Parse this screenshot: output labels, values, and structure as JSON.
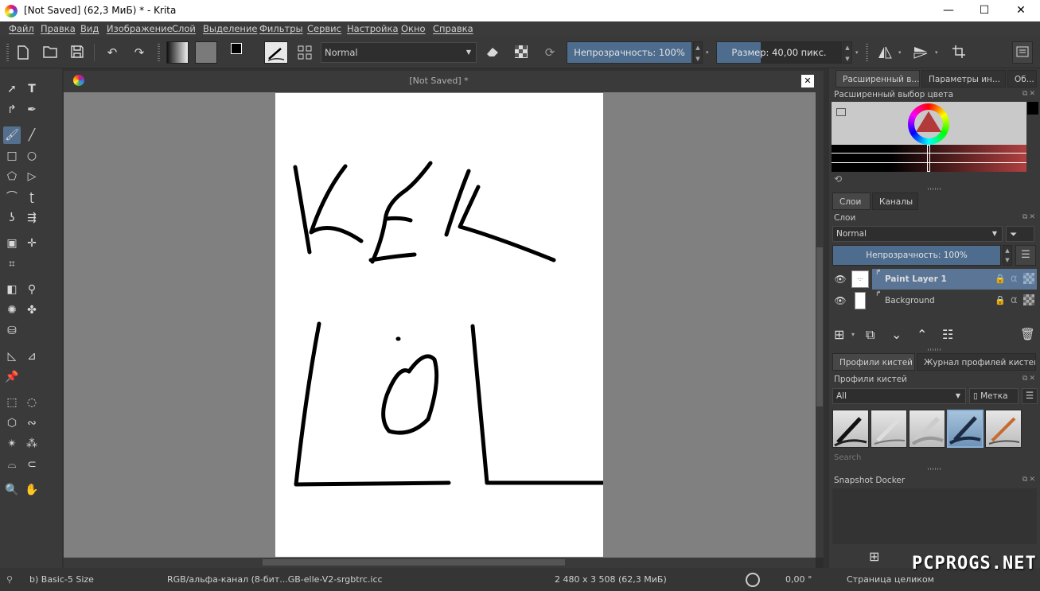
{
  "window": {
    "title": "[Not Saved]  (62,3 МиБ)  * - Krita",
    "minimize": "—",
    "maximize": "☐",
    "close": "✕"
  },
  "menu": [
    "Файл",
    "Правка",
    "Вид",
    "Изображение",
    "Слой",
    "Выделение",
    "Фильтры",
    "Сервис",
    "Настройка",
    "Окно",
    "Справка"
  ],
  "toolbar": {
    "blend_mode": "Normal",
    "opacity_label": "Непрозрачность: 100%",
    "opacity_value": 1.0,
    "size_label": "Размер: 40,00 пикс.",
    "size_fill": 0.35
  },
  "document": {
    "tab_title": "[Not Saved]  *",
    "close": "✕"
  },
  "dock": {
    "tabs": [
      "Расширенный в...",
      "Параметры ин...",
      "Об..."
    ],
    "color_selector_title": "Расширенный выбор цвета",
    "layer_tabs": [
      "Слои",
      "Каналы"
    ],
    "layers_title": "Слои",
    "layers_blend": "Normal",
    "layers_opacity": "Непрозрачность:  100%",
    "layers": [
      {
        "name": "Paint Layer 1",
        "selected": true
      },
      {
        "name": "Background",
        "selected": false
      }
    ],
    "brush_tabs": [
      "Профили кистей",
      "Журнал профилей кистей"
    ],
    "brush_title": "Профили кистей",
    "brush_filter": "All",
    "brush_tag": "Метка",
    "brush_search_placeholder": "Search",
    "snapshot_title": "Snapshot Docker"
  },
  "status": {
    "brush": "b) Basic-5 Size",
    "color_profile": "RGB/альфа-канал (8-бит...GB-elle-V2-srgbtrc.icc",
    "image_size": "2 480 x 3 508 (62,3 МиБ)",
    "rotation": "0,00 °",
    "zoom": "Страница целиком"
  },
  "watermark": "PCPROGS.NET",
  "colors": {
    "accent": "#55708f",
    "slider_fill": "#4e6d8e",
    "background": "#313131",
    "canvas_bg": "#808080"
  }
}
